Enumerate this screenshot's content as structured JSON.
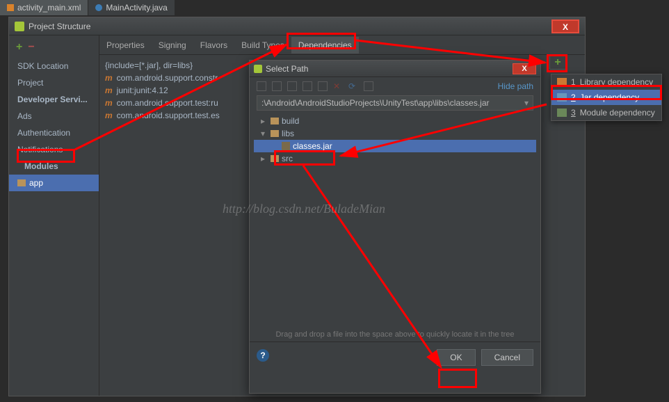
{
  "editor_tabs": {
    "tab1": "activity_main.xml",
    "tab2": "MainActivity.java"
  },
  "ps_window": {
    "title": "Project Structure",
    "left": {
      "sdk": "SDK Location",
      "project": "Project",
      "devserv": "Developer Servi...",
      "ads": "Ads",
      "auth": "Authentication",
      "notif": "Notifications",
      "modules": "Modules",
      "app": "app"
    },
    "tabs": {
      "properties": "Properties",
      "signing": "Signing",
      "flavors": "Flavors",
      "buildtypes": "Build Types",
      "dependencies": "Dependencies"
    },
    "deps": {
      "r0": "{include=[*.jar], dir=libs}",
      "r1": "com.android.support.constr",
      "r2": "junit:junit:4.12",
      "r3": "com.android.support.test:ru",
      "r4": "com.android.support.test.es"
    }
  },
  "dep_menu": {
    "i1_num": "1",
    "i1_txt": "Library dependency",
    "i2_num": "2",
    "i2_txt": "Jar dependency",
    "i3_num": "3",
    "i3_txt": "Module dependency"
  },
  "sp_dialog": {
    "title": "Select Path",
    "hide_path": "Hide path",
    "path": ":\\Android\\AndroidStudioProjects\\UnityTest\\app\\libs\\classes.jar",
    "tree": {
      "build": "build",
      "libs": "libs",
      "classes": "classes.jar",
      "src": "src"
    },
    "hint": "Drag and drop a file into the space above to quickly locate it in the tree",
    "ok": "OK",
    "cancel": "Cancel"
  },
  "watermark": "http://blog.csdn.net/BuladeMian"
}
